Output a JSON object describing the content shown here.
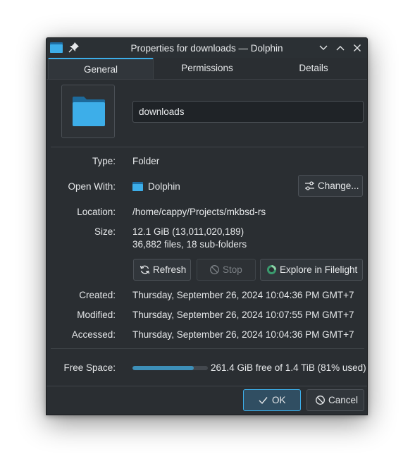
{
  "window": {
    "title": "Properties for downloads — Dolphin",
    "controls": [
      "minimize",
      "maximize",
      "close"
    ]
  },
  "tabs": [
    {
      "label": "General",
      "active": true
    },
    {
      "label": "Permissions",
      "active": false
    },
    {
      "label": "Details",
      "active": false
    }
  ],
  "file": {
    "name": "downloads",
    "icon": "folder-icon"
  },
  "props": {
    "type_label": "Type:",
    "type_value": "Folder",
    "open_with_label": "Open With:",
    "open_with_value": "Dolphin",
    "change_button": "Change...",
    "location_label": "Location:",
    "location_value": "/home/cappy/Projects/mkbsd-rs",
    "size_label": "Size:",
    "size_value": "12.1 GiB (13,011,020,189)",
    "size_detail": "36,882 files, 18 sub-folders",
    "refresh_button": "Refresh",
    "stop_button": "Stop",
    "explore_button": "Explore in Filelight",
    "created_label": "Created:",
    "created_value": "Thursday, September 26, 2024 10:04:36 PM GMT+7",
    "modified_label": "Modified:",
    "modified_value": "Thursday, September 26, 2024 10:07:55 PM GMT+7",
    "accessed_label": "Accessed:",
    "accessed_value": "Thursday, September 26, 2024 10:04:36 PM GMT+7",
    "free_space_label": "Free Space:",
    "free_space_value": "261.4 GiB free of 1.4 TiB (81% used)",
    "used_fraction": 0.81
  },
  "buttons": {
    "ok": "OK",
    "cancel": "Cancel"
  },
  "colors": {
    "accent": "#3daee9",
    "background": "#2a2e32",
    "folder": "#3daee9"
  }
}
